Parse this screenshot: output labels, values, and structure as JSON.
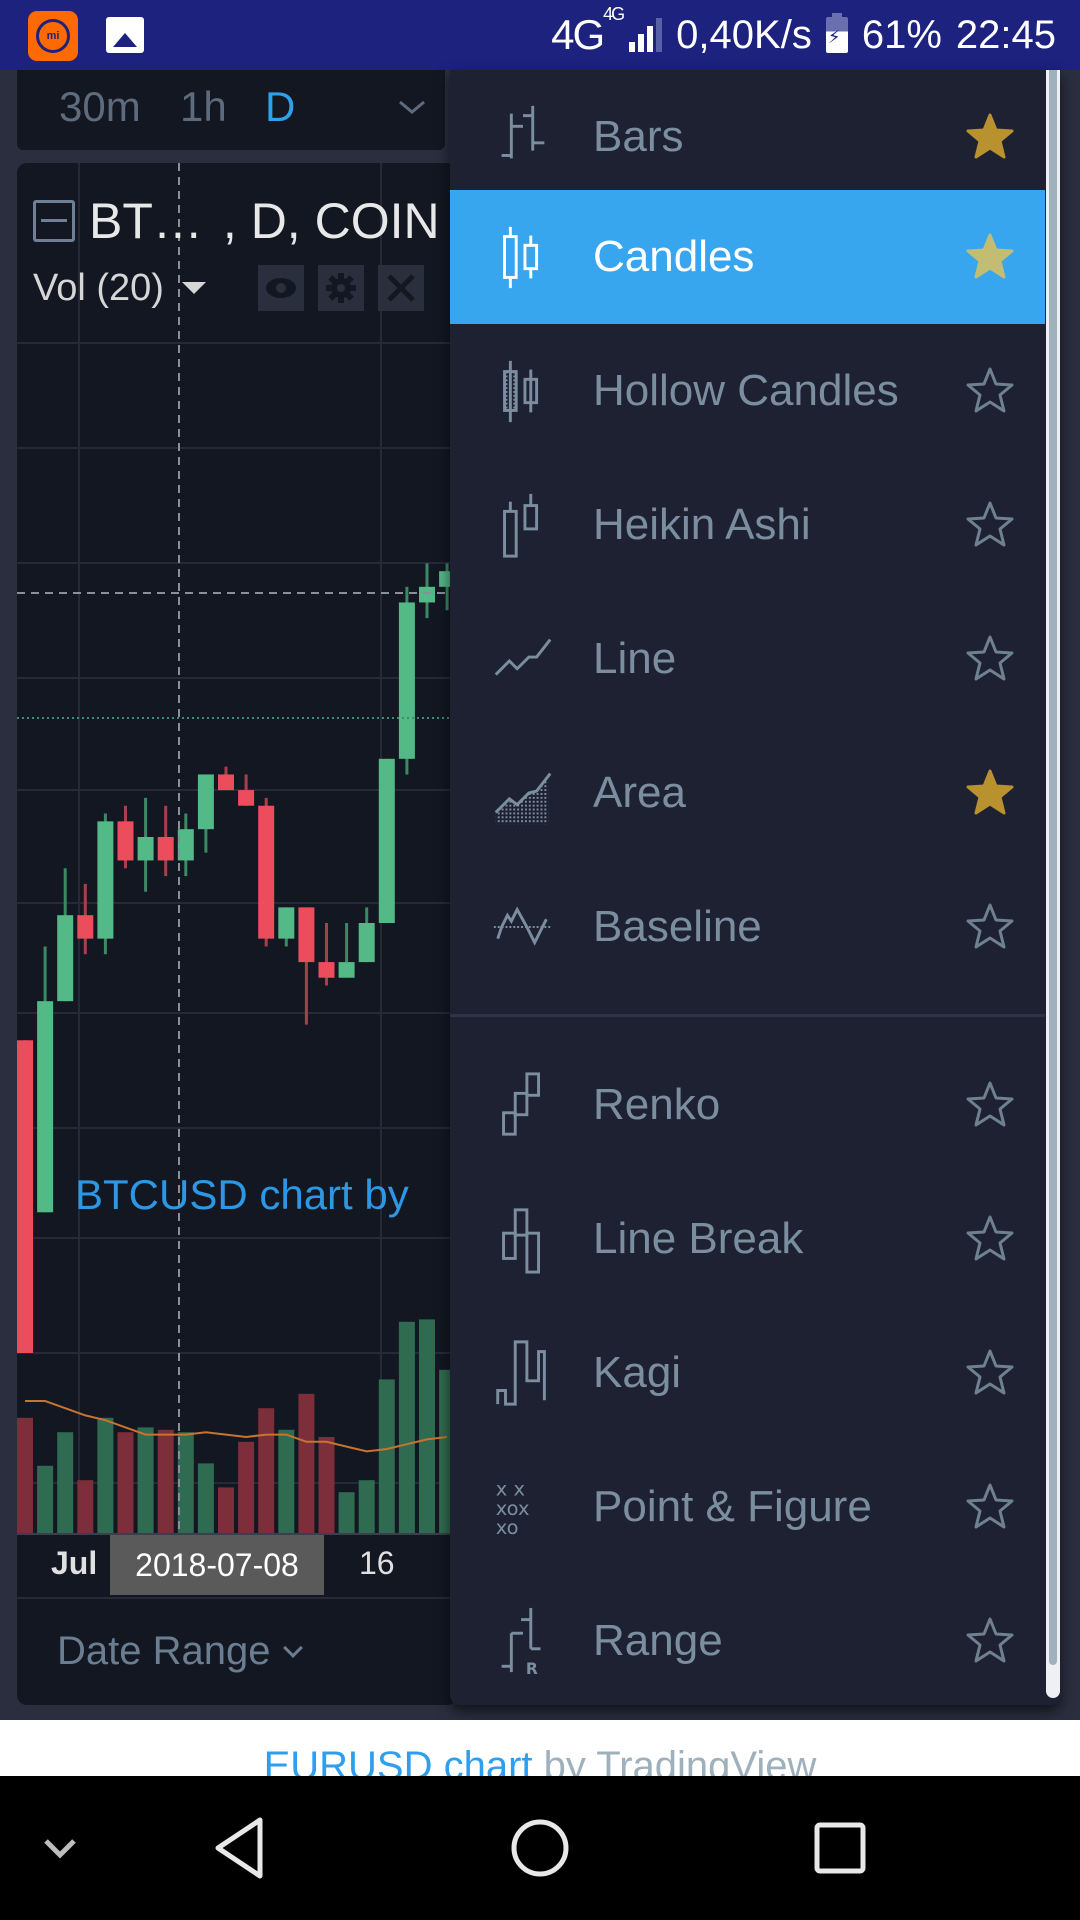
{
  "status_bar": {
    "network_type": "4G",
    "network_sup": "4G",
    "speed": "0,40K/s",
    "battery": "61%",
    "time": "22:45",
    "icons": [
      "mi-app-icon",
      "gallery-icon",
      "signal-icon",
      "battery-charging-icon"
    ]
  },
  "interval_bar": {
    "intervals": [
      {
        "label": "30m",
        "active": false
      },
      {
        "label": "1h",
        "active": false
      },
      {
        "label": "D",
        "active": true
      }
    ],
    "more_icon": "chevron-down-icon"
  },
  "chart": {
    "symbol_title_part1": "BT…",
    "symbol_title_part2": ", D, COIN",
    "indicator_label": "Vol (20)",
    "indicator_buttons": [
      "eye-icon",
      "gear-icon",
      "close-icon"
    ],
    "watermark": "BTCUSD chart by",
    "time_axis": {
      "labels": [
        {
          "text": "Jul",
          "bold": true
        },
        {
          "text": "16",
          "bold": false
        }
      ],
      "cursor_date": "2018-07-08"
    },
    "date_range_label": "Date Range",
    "colors": {
      "up": "#53b987",
      "down": "#eb4d5c",
      "vol_up": "#2f6b50",
      "vol_down": "#7c2e3a",
      "ma": "#c8732e",
      "grid": "#262a38",
      "crosshair": "#8a8f99"
    }
  },
  "chart_data": {
    "type": "candlestick",
    "title": "BTCUSD, D, COINBASE",
    "xlabel": "",
    "ylabel": "",
    "x_tick_labels": [
      "Jul",
      "2018-07-08",
      "16"
    ],
    "candles": [
      {
        "o": 40,
        "h": 40,
        "l": 0,
        "c": 0,
        "dir": "down"
      },
      {
        "o": 18,
        "h": 52,
        "l": 18,
        "c": 45,
        "dir": "up"
      },
      {
        "o": 45,
        "h": 62,
        "l": 45,
        "c": 56,
        "dir": "up"
      },
      {
        "o": 56,
        "h": 60,
        "l": 51,
        "c": 53,
        "dir": "down"
      },
      {
        "o": 53,
        "h": 69,
        "l": 51,
        "c": 68,
        "dir": "up"
      },
      {
        "o": 68,
        "h": 70,
        "l": 62,
        "c": 63,
        "dir": "down"
      },
      {
        "o": 63,
        "h": 71,
        "l": 59,
        "c": 66,
        "dir": "up"
      },
      {
        "o": 66,
        "h": 70,
        "l": 61,
        "c": 63,
        "dir": "down"
      },
      {
        "o": 63,
        "h": 69,
        "l": 61,
        "c": 67,
        "dir": "up"
      },
      {
        "o": 67,
        "h": 73,
        "l": 64,
        "c": 74,
        "dir": "up"
      },
      {
        "o": 74,
        "h": 75,
        "l": 72,
        "c": 72,
        "dir": "down"
      },
      {
        "o": 72,
        "h": 74,
        "l": 70,
        "c": 70,
        "dir": "down"
      },
      {
        "o": 70,
        "h": 71,
        "l": 52,
        "c": 53,
        "dir": "down"
      },
      {
        "o": 53,
        "h": 57,
        "l": 52,
        "c": 57,
        "dir": "up"
      },
      {
        "o": 57,
        "h": 57,
        "l": 42,
        "c": 50,
        "dir": "down"
      },
      {
        "o": 50,
        "h": 55,
        "l": 47,
        "c": 48,
        "dir": "down"
      },
      {
        "o": 48,
        "h": 55,
        "l": 50,
        "c": 50,
        "dir": "up"
      },
      {
        "o": 50,
        "h": 57,
        "l": 50,
        "c": 55,
        "dir": "up"
      },
      {
        "o": 55,
        "h": 76,
        "l": 55,
        "c": 76,
        "dir": "up"
      },
      {
        "o": 76,
        "h": 98,
        "l": 74,
        "c": 96,
        "dir": "up"
      },
      {
        "o": 96,
        "h": 101,
        "l": 94,
        "c": 98,
        "dir": "up"
      },
      {
        "o": 98,
        "h": 101,
        "l": 95,
        "c": 100,
        "dir": "up"
      }
    ],
    "volume": [
      {
        "v": 48,
        "dir": "down"
      },
      {
        "v": 28,
        "dir": "up"
      },
      {
        "v": 42,
        "dir": "up"
      },
      {
        "v": 22,
        "dir": "down"
      },
      {
        "v": 48,
        "dir": "up"
      },
      {
        "v": 42,
        "dir": "down"
      },
      {
        "v": 44,
        "dir": "up"
      },
      {
        "v": 43,
        "dir": "down"
      },
      {
        "v": 42,
        "dir": "up"
      },
      {
        "v": 29,
        "dir": "up"
      },
      {
        "v": 19,
        "dir": "down"
      },
      {
        "v": 38,
        "dir": "down"
      },
      {
        "v": 52,
        "dir": "down"
      },
      {
        "v": 43,
        "dir": "up"
      },
      {
        "v": 58,
        "dir": "down"
      },
      {
        "v": 40,
        "dir": "down"
      },
      {
        "v": 17,
        "dir": "up"
      },
      {
        "v": 22,
        "dir": "up"
      },
      {
        "v": 64,
        "dir": "up"
      },
      {
        "v": 88,
        "dir": "up"
      },
      {
        "v": 89,
        "dir": "up"
      },
      {
        "v": 68,
        "dir": "up"
      }
    ],
    "volume_ma": [
      55,
      55,
      52,
      49,
      47,
      44,
      41,
      41,
      41,
      42,
      41,
      40,
      41,
      41,
      38,
      38,
      36,
      34,
      35,
      37,
      39,
      40
    ],
    "price_ylim": [
      0,
      110
    ],
    "volume_ylim": [
      0,
      100
    ],
    "grid": true,
    "crosshair_index": 10
  },
  "chart_type_menu": {
    "items": [
      {
        "label": "Bars",
        "icon": "bars-icon",
        "favorite": true,
        "selected": false
      },
      {
        "label": "Candles",
        "icon": "candles-icon",
        "favorite": true,
        "selected": true
      },
      {
        "label": "Hollow Candles",
        "icon": "hollow-candles-icon",
        "favorite": false,
        "selected": false
      },
      {
        "label": "Heikin Ashi",
        "icon": "heikin-ashi-icon",
        "favorite": false,
        "selected": false
      },
      {
        "label": "Line",
        "icon": "line-icon",
        "favorite": false,
        "selected": false
      },
      {
        "label": "Area",
        "icon": "area-icon",
        "favorite": true,
        "selected": false
      },
      {
        "label": "Baseline",
        "icon": "baseline-icon",
        "favorite": false,
        "selected": false
      },
      {
        "label": "Renko",
        "icon": "renko-icon",
        "favorite": false,
        "selected": false
      },
      {
        "label": "Line Break",
        "icon": "line-break-icon",
        "favorite": false,
        "selected": false
      },
      {
        "label": "Kagi",
        "icon": "kagi-icon",
        "favorite": false,
        "selected": false
      },
      {
        "label": "Point & Figure",
        "icon": "point-figure-icon",
        "favorite": false,
        "selected": false
      },
      {
        "label": "Range",
        "icon": "range-icon",
        "favorite": false,
        "selected": false
      }
    ],
    "colors": {
      "selected_bg": "#38a6ee",
      "star_fav": "#b8922e",
      "star_fav_selected": "#c2bd72",
      "star_empty": "#6f8090",
      "icon": "#7b8ea0"
    }
  },
  "footer": {
    "link_text": "EURUSD chart",
    "suffix_text": " by TradingView"
  },
  "nav_bar": {
    "buttons": [
      "hide-nav-icon",
      "back-icon",
      "home-icon",
      "recents-icon"
    ]
  }
}
